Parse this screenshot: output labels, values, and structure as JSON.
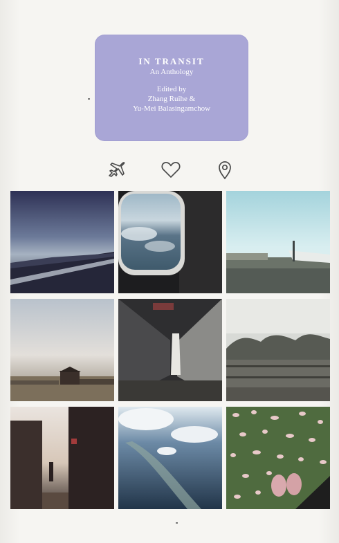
{
  "cover": {
    "title": "IN TRANSIT",
    "subtitle": "An Anthology",
    "edited_by": "Edited by",
    "editors": [
      "Zhang Ruihe &",
      "Yu-Mei Balasingamchow"
    ]
  },
  "icons": [
    "airplane-icon",
    "heart-icon",
    "location-pin-icon"
  ],
  "colors": {
    "title_box": "#a9a6d6",
    "background": "#f3f2ef",
    "icon_stroke": "#4a4a4a"
  },
  "photos": [
    "airplane-wing-sky-photo",
    "airplane-window-view-photo",
    "airport-tarmac-photo",
    "shore-dusk-huts-photo",
    "jet-bridge-interior-photo",
    "trees-railway-photo",
    "train-platform-sunset-photo",
    "aerial-coastline-photo",
    "petals-on-grass-feet-photo"
  ]
}
